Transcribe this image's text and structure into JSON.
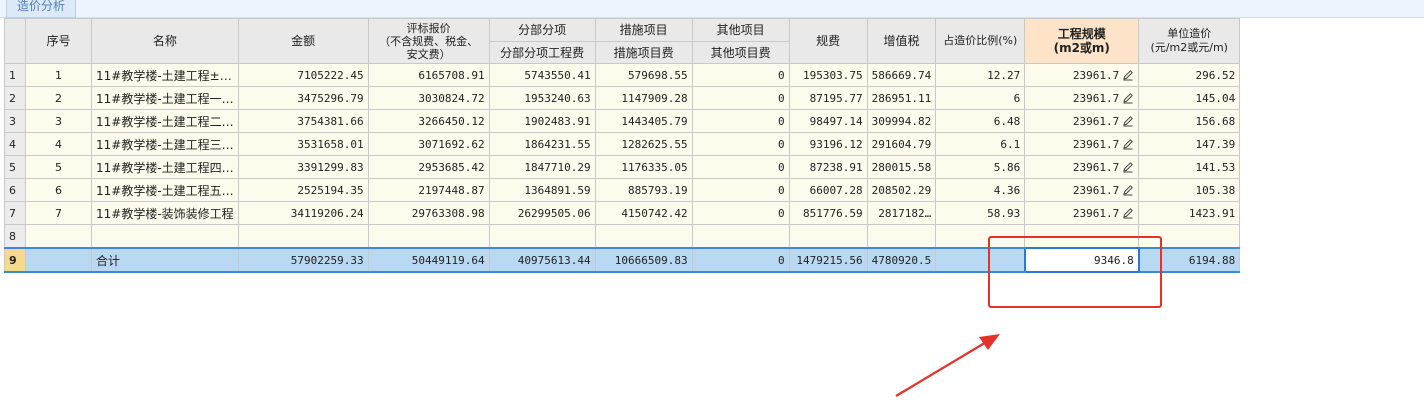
{
  "tab": {
    "label": "造价分析"
  },
  "headers": {
    "seq": "序号",
    "name": "名称",
    "amount": "金额",
    "bid_price": "评标报价\n（不含规费、税金、\n安文费）",
    "sub_group": "分部分项",
    "sub_fee": "分部分项工程费",
    "measure_group": "措施项目",
    "measure_fee": "措施项目费",
    "other_group": "其他项目",
    "other_fee": "其他项目费",
    "regulation_fee": "规费",
    "vat": "增值税",
    "ratio": "占造价比例(%)",
    "scale": "工程规模\n(m2或m)",
    "unit_cost": "单位造价\n(元/m2或元/m)"
  },
  "rows": [
    {
      "rn": "1",
      "seq": "1",
      "name": "11#教学楼-土建工程±…",
      "amount": "7105222.45",
      "bid": "6165708.91",
      "sub": "5743550.41",
      "measure": "579698.55",
      "other": "0",
      "reg": "195303.75",
      "vat": "586669.74",
      "ratio": "12.27",
      "scale": "23961.7",
      "unit": "296.52"
    },
    {
      "rn": "2",
      "seq": "2",
      "name": "11#教学楼-土建工程一…",
      "amount": "3475296.79",
      "bid": "3030824.72",
      "sub": "1953240.63",
      "measure": "1147909.28",
      "other": "0",
      "reg": "87195.77",
      "vat": "286951.11",
      "ratio": "6",
      "scale": "23961.7",
      "unit": "145.04"
    },
    {
      "rn": "3",
      "seq": "3",
      "name": "11#教学楼-土建工程二…",
      "amount": "3754381.66",
      "bid": "3266450.12",
      "sub": "1902483.91",
      "measure": "1443405.79",
      "other": "0",
      "reg": "98497.14",
      "vat": "309994.82",
      "ratio": "6.48",
      "scale": "23961.7",
      "unit": "156.68"
    },
    {
      "rn": "4",
      "seq": "4",
      "name": "11#教学楼-土建工程三…",
      "amount": "3531658.01",
      "bid": "3071692.62",
      "sub": "1864231.55",
      "measure": "1282625.55",
      "other": "0",
      "reg": "93196.12",
      "vat": "291604.79",
      "ratio": "6.1",
      "scale": "23961.7",
      "unit": "147.39"
    },
    {
      "rn": "5",
      "seq": "5",
      "name": "11#教学楼-土建工程四…",
      "amount": "3391299.83",
      "bid": "2953685.42",
      "sub": "1847710.29",
      "measure": "1176335.05",
      "other": "0",
      "reg": "87238.91",
      "vat": "280015.58",
      "ratio": "5.86",
      "scale": "23961.7",
      "unit": "141.53"
    },
    {
      "rn": "6",
      "seq": "6",
      "name": "11#教学楼-土建工程五…",
      "amount": "2525194.35",
      "bid": "2197448.87",
      "sub": "1364891.59",
      "measure": "885793.19",
      "other": "0",
      "reg": "66007.28",
      "vat": "208502.29",
      "ratio": "4.36",
      "scale": "23961.7",
      "unit": "105.38"
    },
    {
      "rn": "7",
      "seq": "7",
      "name": "11#教学楼-装饰装修工程",
      "amount": "34119206.24",
      "bid": "29763308.98",
      "sub": "26299505.06",
      "measure": "4150742.42",
      "other": "0",
      "reg": "851776.59",
      "vat": "2817182…",
      "ratio": "58.93",
      "scale": "23961.7",
      "unit": "1423.91"
    },
    {
      "rn": "8",
      "seq": "",
      "name": "",
      "amount": "",
      "bid": "",
      "sub": "",
      "measure": "",
      "other": "",
      "reg": "",
      "vat": "",
      "ratio": "",
      "scale": "",
      "unit": ""
    }
  ],
  "total": {
    "rn": "9",
    "seq": "",
    "name": "合计",
    "amount": "57902259.33",
    "bid": "50449119.64",
    "sub": "40975613.44",
    "measure": "10666509.83",
    "other": "0",
    "reg": "1479215.56",
    "vat": "4780920.5",
    "ratio": "",
    "scale": "9346.8",
    "unit": "6194.88"
  },
  "colors": {
    "highlight": "#e5332a",
    "selection": "#2a7ad5"
  },
  "icons": {
    "edit": "pencil-icon"
  }
}
